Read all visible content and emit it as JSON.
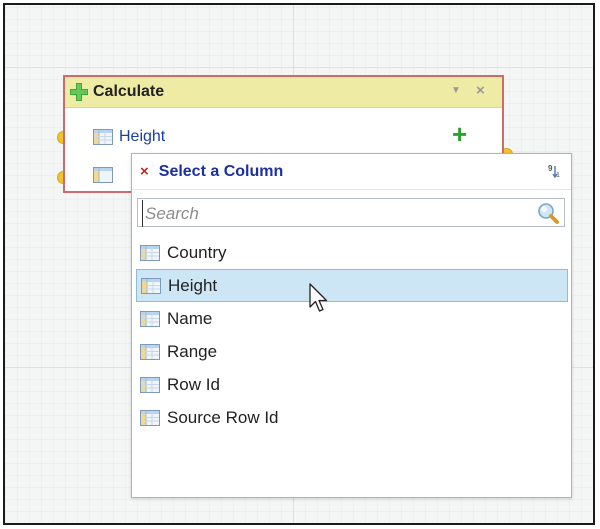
{
  "node": {
    "title": "Calculate",
    "dropdown_glyph": "▼",
    "close_glyph": "×",
    "add_glyph": "+",
    "rows": [
      {
        "label": "Height",
        "icon": "table-column-icon"
      },
      {
        "label": "",
        "icon": "table-column-icon"
      }
    ]
  },
  "popup": {
    "close_glyph": "×",
    "title": "Select a Column",
    "sort_icon": "sort-numeric-icon",
    "search": {
      "placeholder": "Search",
      "value": ""
    },
    "items": [
      {
        "label": "Country",
        "selected": false
      },
      {
        "label": "Height",
        "selected": true
      },
      {
        "label": "Name",
        "selected": false
      },
      {
        "label": "Range",
        "selected": false
      },
      {
        "label": "Row Id",
        "selected": false
      },
      {
        "label": "Source Row Id",
        "selected": false
      }
    ]
  },
  "colors": {
    "header_bg": "#eeeba4",
    "node_border": "#d0696a",
    "link_blue": "#1a3ea8",
    "title_blue": "#1c2fa3",
    "selected_bg": "#cde6f6",
    "add_green": "#2aa12a",
    "close_red": "#c0281e"
  }
}
